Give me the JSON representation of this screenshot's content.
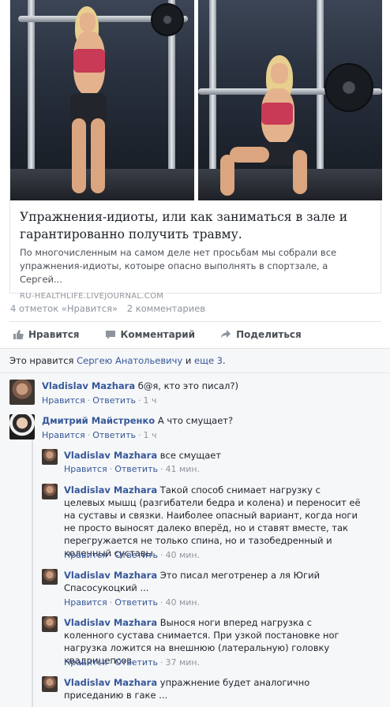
{
  "post": {
    "title": "Упражнения-идиоты, или как заниматься в зале и гарантированно получить травму.",
    "description": "По многочисленным на самом деле нет просьбам мы собрали все упражнения-идиоты, котоыре опасно выполнять в спортзале, а Сергей...",
    "domain": "RU-HEALTHLIFE.LIVEJOURNAL.COM"
  },
  "stats": {
    "likes": "4 отметок «Нравится»",
    "comments": "2 комментариев"
  },
  "actions": {
    "like": "Нравится",
    "comment": "Комментарий",
    "share": "Поделиться"
  },
  "likes_line": {
    "prefix": "Это нравится",
    "person": "Сергею Анатольевичу",
    "and": "и",
    "more": "еще 3",
    "end": "."
  },
  "comments": [
    {
      "author": "Vladislav Mazhara",
      "text": "б@я, кто это писал?)",
      "like": "Нравится",
      "reply": "Ответить",
      "time": "1 ч"
    },
    {
      "author": "Дмитрий Майстренко",
      "text": "А что смущает?",
      "like": "Нравится",
      "reply": "Ответить",
      "time": "1 ч"
    },
    {
      "author": "Vladislav Mazhara",
      "text": "все смущает",
      "like": "Нравится",
      "reply": "Ответить",
      "time": "41 мин."
    },
    {
      "author": "Vladislav Mazhara",
      "text": "Такой способ снимает нагрузку с целевых мышц (разгибатели бедра и колена) и переносит её на суставы и связки. Наиболее опасный вариант, когда ноги не просто выносят далеко вперёд, но и ставят вместе, так перегружается не только спина, но и тазобедренный и коленный суставы.",
      "like": "Нравится",
      "reply": "Ответить",
      "time": "40 мин."
    },
    {
      "author": "Vladislav Mazhara",
      "text": "Это писал меготренер а ля Югий Спасосукоцкий ...",
      "like": "Нравится",
      "reply": "Ответить",
      "time": "40 мин."
    },
    {
      "author": "Vladislav Mazhara",
      "text": "Вынося ноги вперед нагрузка с коленного сустава снимается. При узкой постановке ног нагрузка ложится на внешнюю (латеральную) головку квадрицепсов.",
      "like": "Нравится",
      "reply": "Ответить",
      "time": "37 мин."
    },
    {
      "author": "Vladislav Mazhara",
      "text": "упражнение будет аналогично приседанию в гаке ...",
      "like": "",
      "reply": "",
      "time": ""
    }
  ],
  "colors": {
    "link": "#365899",
    "meta": "#90949c",
    "comments_bg": "#f6f7f9"
  },
  "icons": [
    "thumbs-up-icon",
    "comment-icon",
    "share-icon"
  ]
}
